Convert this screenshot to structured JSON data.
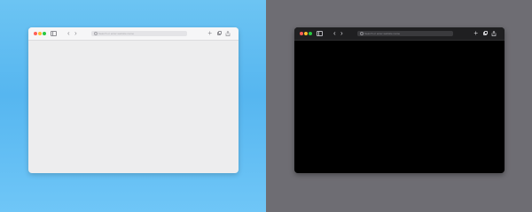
{
  "windows": [
    {
      "theme": "light",
      "background": "#5ab8f1",
      "window_bg": "#ededee",
      "nav": {
        "back": "‹",
        "forward": "›",
        "new_tab": "+"
      },
      "address": {
        "placeholder": "Search or enter website name"
      },
      "icons": [
        "sidebar-icon",
        "search-icon",
        "new-tab-icon",
        "tabs-overview-icon",
        "share-icon"
      ]
    },
    {
      "theme": "dark",
      "background": "#6e6d73",
      "window_bg": "#000000",
      "nav": {
        "back": "‹",
        "forward": "›",
        "new_tab": "+"
      },
      "address": {
        "placeholder": "Search or enter website name"
      },
      "icons": [
        "sidebar-icon",
        "search-icon",
        "new-tab-icon",
        "tabs-overview-icon",
        "share-icon"
      ]
    }
  ]
}
